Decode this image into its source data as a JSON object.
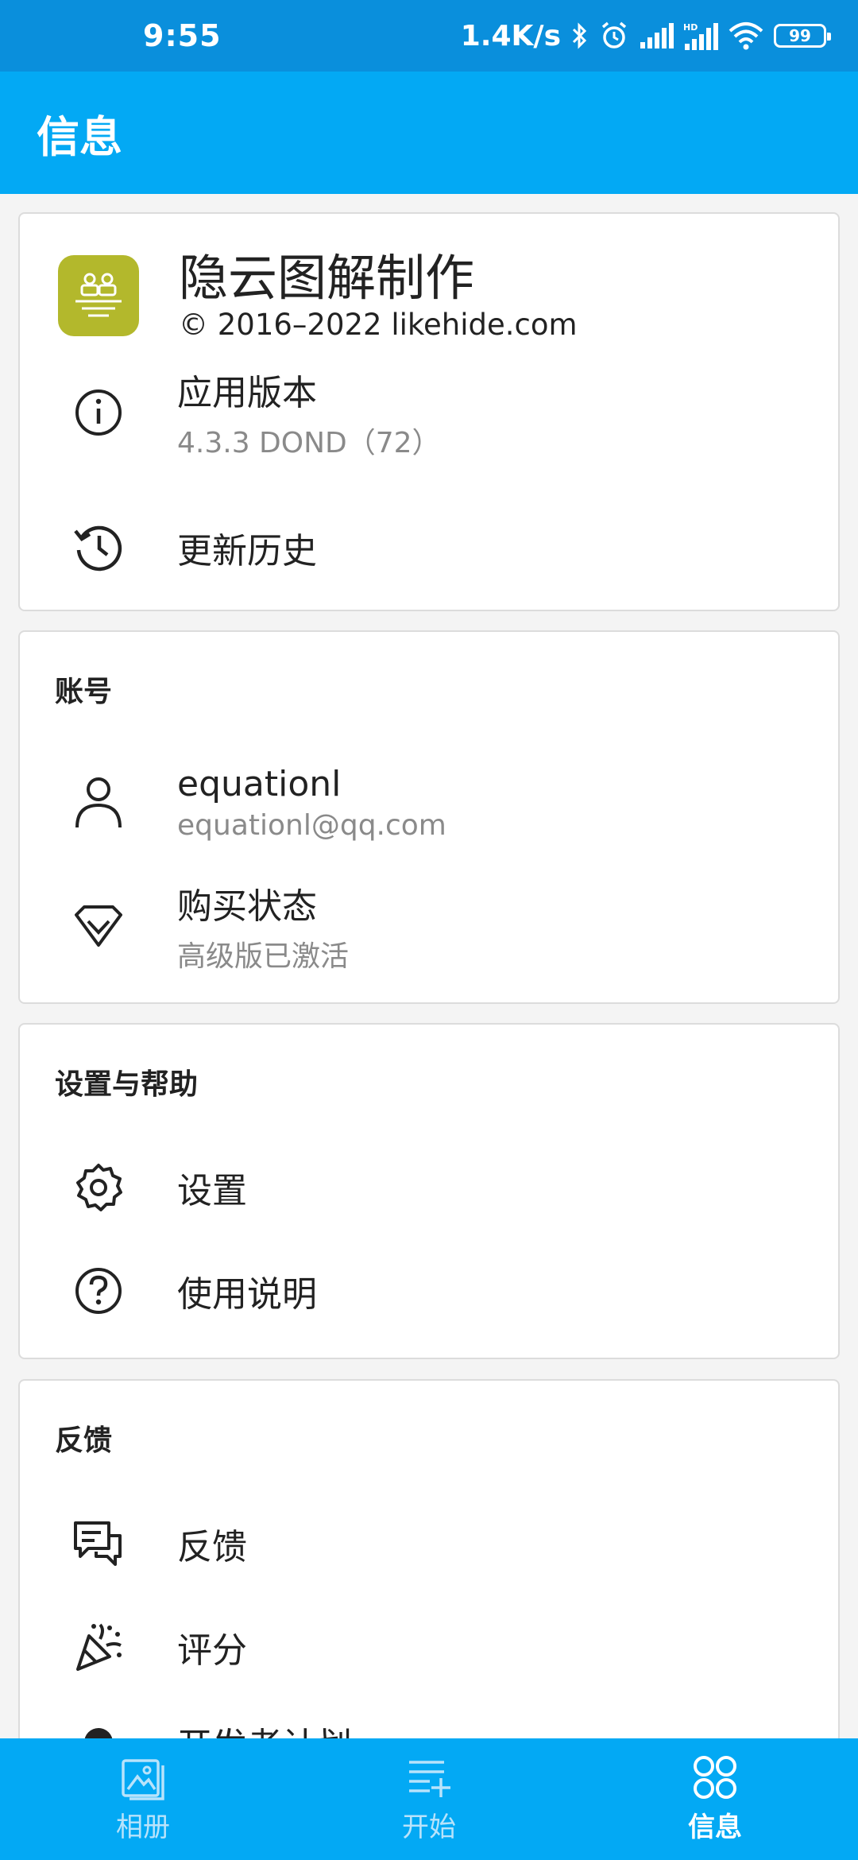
{
  "status_bar": {
    "time": "9:55",
    "net_speed": "1.4K/s",
    "battery": "99"
  },
  "header": {
    "title": "信息"
  },
  "about": {
    "app_name": "隐云图解制作",
    "copyright": "© 2016–2022 likehide.com",
    "version_label": "应用版本",
    "version_value": "4.3.3 DOND（72）",
    "history_label": "更新历史"
  },
  "account": {
    "section_title": "账号",
    "username": "equationl",
    "email": "equationl@qq.com",
    "purchase_label": "购买状态",
    "purchase_value": "高级版已激活"
  },
  "settings_help": {
    "section_title": "设置与帮助",
    "settings_label": "设置",
    "manual_label": "使用说明"
  },
  "feedback": {
    "section_title": "反馈",
    "feedback_label": "反馈",
    "rate_label": "评分",
    "partial_label": "开发者计划"
  },
  "bottom_nav": {
    "items": [
      {
        "label": "相册",
        "icon": "album-icon",
        "active": false
      },
      {
        "label": "开始",
        "icon": "list-add-icon",
        "active": false
      },
      {
        "label": "信息",
        "icon": "grid-circles-icon",
        "active": true
      }
    ]
  },
  "colors": {
    "status_bar": "#0a8fdc",
    "app_bar": "#03a9f4",
    "app_icon": "#b3b82c"
  }
}
